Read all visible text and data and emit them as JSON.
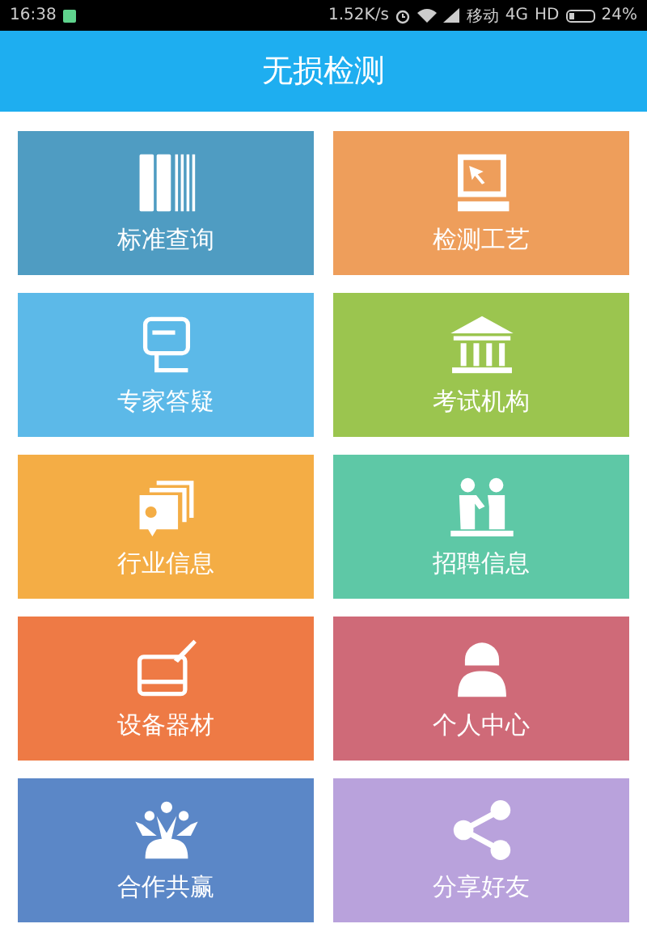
{
  "status_bar": {
    "time": "16:38",
    "speed": "1.52K/s",
    "carrier": "移动",
    "network": "4G",
    "hd": "HD",
    "battery": "24%"
  },
  "header": {
    "title": "无损检测"
  },
  "tiles": [
    {
      "label": "标准查询",
      "kind": "books",
      "color": "#4f9cc2"
    },
    {
      "label": "检测工艺",
      "kind": "computer",
      "color": "#ee9e5b"
    },
    {
      "label": "专家答疑",
      "kind": "chat",
      "color": "#5cb9e8"
    },
    {
      "label": "考试机构",
      "kind": "building",
      "color": "#9bc54f"
    },
    {
      "label": "行业信息",
      "kind": "cards",
      "color": "#f4ad45"
    },
    {
      "label": "招聘信息",
      "kind": "handshake",
      "color": "#5ec8a6"
    },
    {
      "label": "设备器材",
      "kind": "device",
      "color": "#ee7a45"
    },
    {
      "label": "个人中心",
      "kind": "person",
      "color": "#cf6a78"
    },
    {
      "label": "合作共赢",
      "kind": "team",
      "color": "#5b87c7"
    },
    {
      "label": "分享好友",
      "kind": "share",
      "color": "#b9a2dc"
    }
  ]
}
